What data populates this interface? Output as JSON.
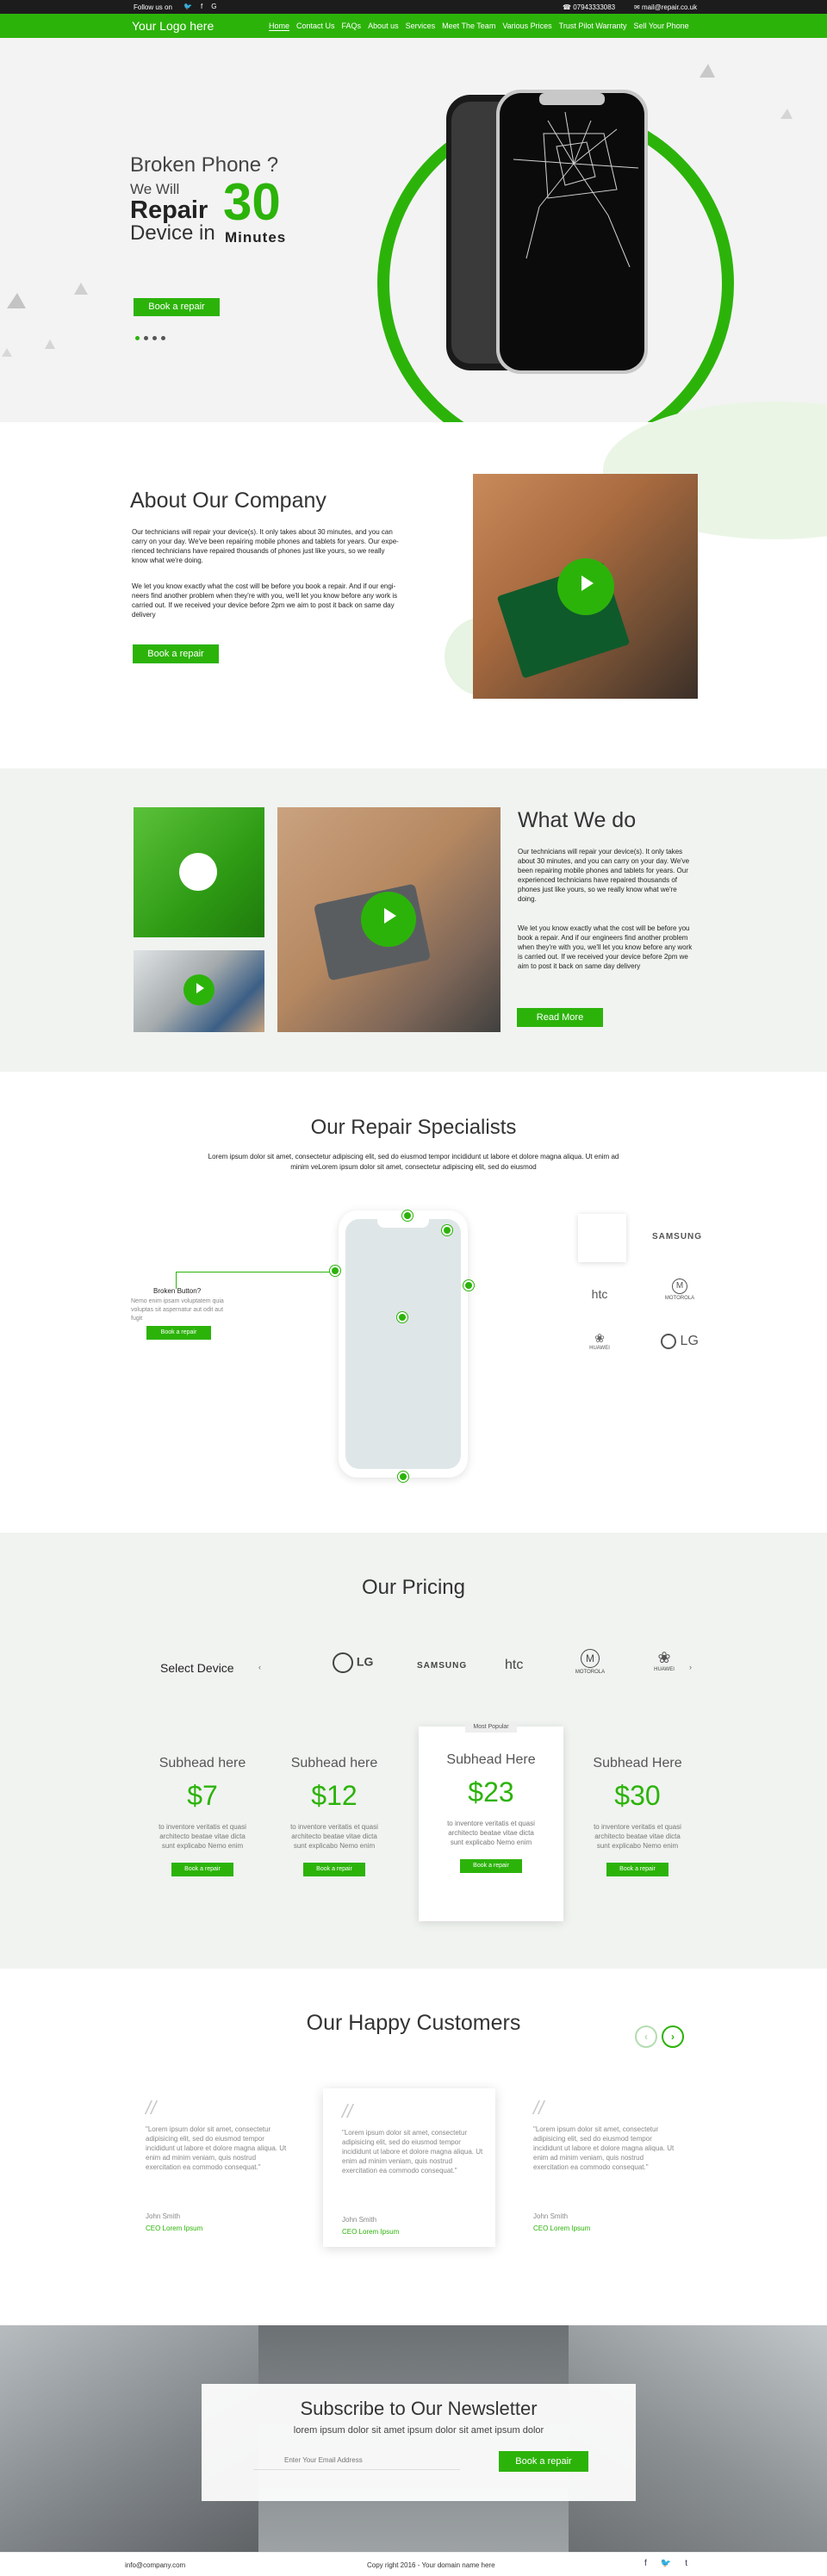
{
  "topbar": {
    "follow": "Follow us on",
    "phone": "07943333083",
    "email": "mail@repair.co.uk",
    "social_icons": [
      "twitter-icon",
      "facebook-icon",
      "google-plus-icon"
    ]
  },
  "header": {
    "logo": "Your Logo here",
    "nav": [
      "Home",
      "Contact Us",
      "FAQs",
      "About us",
      "Services",
      "Meet The Team",
      "Various Prices",
      "Trust Pilot Warranty",
      "Sell Your Phone"
    ],
    "active": "Home"
  },
  "hero": {
    "line1": "Broken Phone ?",
    "line2": "We Will",
    "line3": "Repair",
    "line4": "Device in",
    "number": "30",
    "unit": "Minutes",
    "button": "Book a repair",
    "slides": 4,
    "active_slide": 1
  },
  "about": {
    "title": "About Our Company",
    "p1": "Our technicians will repair your device(s). It only takes about 30 minutes, and you can carry on your day. We've been repairing mobile phones and tablets for years. Our expe-rienced technicians have repaired thousands of phones just like yours, so we really know what we're doing.",
    "p2": "We let you know exactly what the cost will be before you book a repair. And if our engi-neers find another problem when they're with you, we'll let you know before any work is carried out. If we received your device before 2pm we aim to post it back on same day delivery",
    "button": "Book a repair"
  },
  "what": {
    "title": "What We do",
    "p1": "Our technicians will repair your device(s). It only takes about 30 minutes, and you can carry on your day. We've been repairing mobile phones and tablets for years. Our experienced technicians have repaired thousands of phones just like yours, so we really know what we're doing.",
    "p2": "We let you know exactly what the cost will be before you book a repair. And if our engineers find another problem when they're with you, we'll let you know before any work is carried out. If we received your device before 2pm we aim to post it back on same day delivery",
    "button": "Read More"
  },
  "specialists": {
    "title": "Our Repair Specialists",
    "subtitle": "Lorem ipsum dolor sit amet, consectetur adipiscing elit, sed do eiusmod tempor incididunt ut labore et dolore magna aliqua. Ut enim ad minim veLorem ipsum dolor sit amet, consectetur adipiscing elit, sed do eiusmod",
    "callout_title": "Broken Button?",
    "callout_desc": "Nemo enim ipsam voluptatem quia voluptas sit aspernatur aut odit aut fugit",
    "callout_button": "Book a repair",
    "brands": [
      "apple-icon",
      "SAMSUNG",
      "htc",
      "MOTOROLA",
      "HUAWEI",
      "LG"
    ]
  },
  "pricing": {
    "title": "Our Pricing",
    "select_label": "Select Device",
    "brands": [
      "apple-icon",
      "LG",
      "SAMSUNG",
      "htc",
      "MOTOROLA",
      "HUAWEI"
    ],
    "plans": [
      {
        "subhead": "Subhead here",
        "price": "$7",
        "desc": "to inventore veritatis et quasi architecto beatae vitae dicta sunt explicabo Nemo enim",
        "button": "Book a repair"
      },
      {
        "subhead": "Subhead here",
        "price": "$12",
        "desc": "to inventore veritatis et quasi architecto beatae vitae dicta sunt explicabo Nemo enim",
        "button": "Book a repair"
      },
      {
        "subhead": "Subhead Here",
        "price": "$23",
        "desc": "to inventore veritatis et quasi architecto beatae vitae dicta sunt explicabo Nemo enim",
        "button": "Book a repair",
        "tag": "Most Popular"
      },
      {
        "subhead": "Subhead Here",
        "price": "$30",
        "desc": "to inventore veritatis et quasi architecto beatae vitae dicta sunt explicabo Nemo enim",
        "button": "Book a repair"
      }
    ]
  },
  "testimonials": {
    "title": "Our Happy Customers",
    "items": [
      {
        "text": "\"Lorem ipsum dolor sit amet, consectetur adipisicing elit, sed do eiusmod tempor incididunt ut labore et dolore magna aliqua. Ut enim ad minim veniam, quis nostrud exercitation ea commodo consequat.\"",
        "name": "John Smith",
        "role": "CEO Lorem Ipsum"
      },
      {
        "text": "\"Lorem ipsum dolor sit amet, consectetur adipisicing elit, sed do eiusmod tempor incididunt ut labore et dolore magna aliqua. Ut enim ad minim veniam, quis nostrud exercitation ea commodo consequat.\"",
        "name": "John Smith",
        "role": "CEO Lorem Ipsum"
      },
      {
        "text": "\"Lorem ipsum dolor sit amet, consectetur adipisicing elit, sed do eiusmod tempor incididunt ut labore et dolore magna aliqua. Ut enim ad minim veniam, quis nostrud exercitation ea commodo consequat.\"",
        "name": "John Smith",
        "role": "CEO Lorem Ipsum"
      }
    ]
  },
  "newsletter": {
    "title": "Subscribe to Our Newsletter",
    "subtitle": "lorem ipsum dolor sit amet ipsum dolor sit amet ipsum dolor",
    "placeholder": "Enter Your Email Address",
    "button": "Book a repair"
  },
  "footer": {
    "email": "info@company.com",
    "copyright": "Copy right 2016 - Your domain name here",
    "social_icons": [
      "facebook-icon",
      "twitter-icon",
      "tumblr-icon"
    ]
  },
  "colors": {
    "accent": "#2cb30a",
    "dark": "#1c1c1c",
    "section_bg": "#f0f3f0"
  }
}
